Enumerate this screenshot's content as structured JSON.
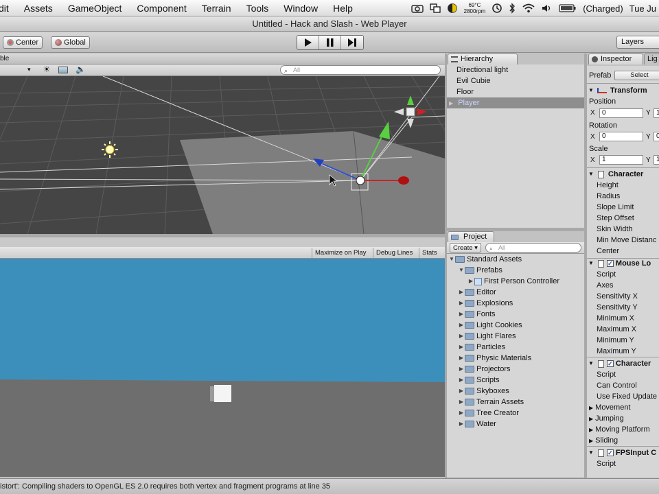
{
  "menubar": {
    "menus": [
      "dit",
      "Assets",
      "GameObject",
      "Component",
      "Terrain",
      "Tools",
      "Window",
      "Help"
    ],
    "temp": "69°C",
    "rpm": "2800rpm",
    "battery": "(Charged)",
    "clock": "Tue Ju"
  },
  "window": {
    "title": "Untitled - Hack and Slash - Web Player"
  },
  "toolbar": {
    "center_label": "Center",
    "global_label": "Global",
    "layers_label": "Layers"
  },
  "scene": {
    "tab_fragment": "ble",
    "search_placeholder": "All",
    "colors": {
      "grid_bg": "#4a4a4a",
      "plane": "#7e7e7e"
    }
  },
  "game": {
    "maximize_label": "Maximize on Play",
    "debug_label": "Debug Lines",
    "stats_label": "Stats",
    "colors": {
      "sky": "#3d8fbb",
      "ground": "#6e6e6e"
    }
  },
  "hierarchy": {
    "tab_label": "Hierarchy",
    "items": [
      "Directional light",
      "Evil Cubie",
      "Floor",
      "Player"
    ],
    "selected": "Player"
  },
  "project": {
    "tab_label": "Project",
    "create_label": "Create",
    "search_placeholder": "All",
    "root": "Standard Assets",
    "prefabs": "Prefabs",
    "prefab_item": "First Person Controller",
    "folders": [
      "Editor",
      "Explosions",
      "Fonts",
      "Light Cookies",
      "Light Flares",
      "Particles",
      "Physic Materials",
      "Projectors",
      "Scripts",
      "Skyboxes",
      "Terrain Assets",
      "Tree Creator",
      "Water"
    ]
  },
  "inspector": {
    "tab_label": "Inspector",
    "tab2_label": "Lig",
    "prefab_label": "Prefab",
    "select_label": "Select",
    "transform_label": "Transform",
    "position_label": "Position",
    "rotation_label": "Rotation",
    "scale_label": "Scale",
    "x_label": "X",
    "y_label": "Y",
    "pos_x": "0",
    "rot_x": "0",
    "scale_x": "1",
    "y_value_fragment": "1",
    "y_value_fragment_rot": "0",
    "character_label": "Character",
    "character_fields": [
      "Height",
      "Radius",
      "Slope Limit",
      "Step Offset",
      "Skin Width",
      "Min Move Distanc",
      "Center"
    ],
    "mouselook_label": "Mouse Lo",
    "mouselook_fields": [
      "Script",
      "Axes",
      "Sensitivity X",
      "Sensitivity Y",
      "Minimum X",
      "Maximum X",
      "Minimum Y",
      "Maximum Y"
    ],
    "character2_label": "Character",
    "character2_fields": [
      "Script",
      "Can Control",
      "Use Fixed Update"
    ],
    "character2_groups": [
      "Movement",
      "Jumping",
      "Moving Platform",
      "Sliding"
    ],
    "fps_label": "FPSInput C",
    "fps_fields": [
      "Script"
    ]
  },
  "status": {
    "message": "istort': Compiling shaders to OpenGL ES 2.0 requires both vertex and fragment programs at line 35"
  }
}
